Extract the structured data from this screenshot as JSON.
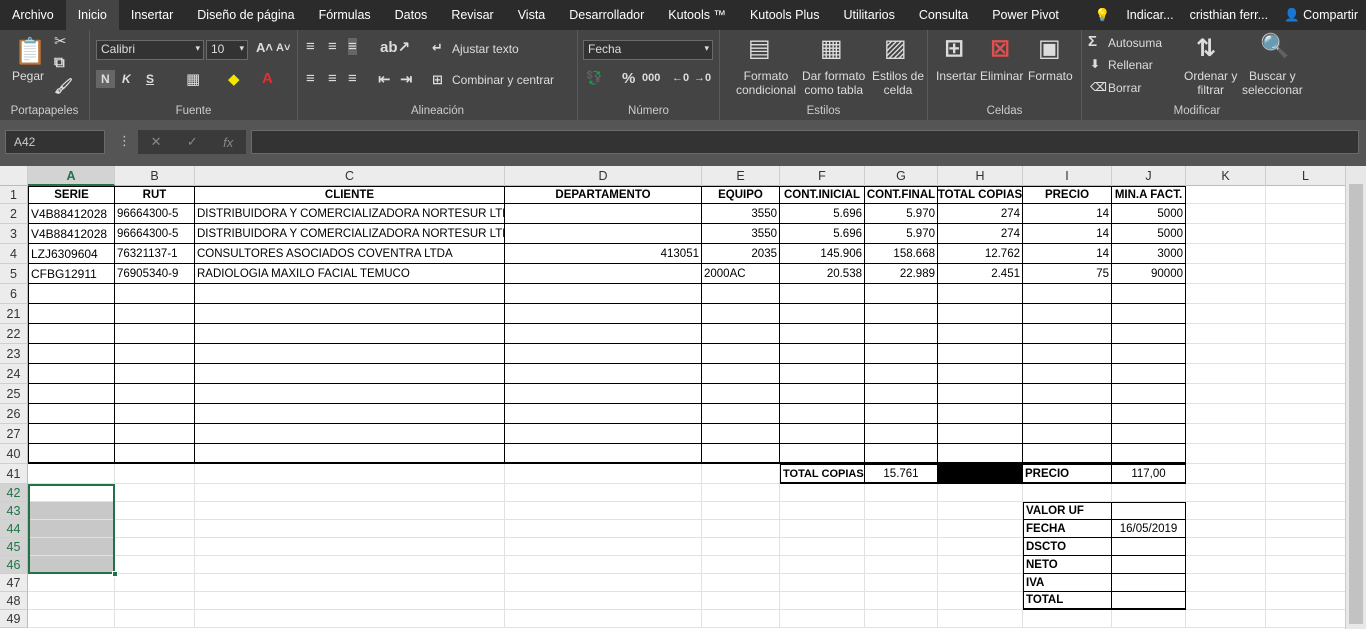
{
  "menu": {
    "tabs": [
      "Archivo",
      "Inicio",
      "Insertar",
      "Diseño de página",
      "Fórmulas",
      "Datos",
      "Revisar",
      "Vista",
      "Desarrollador",
      "Kutools ™",
      "Kutools Plus",
      "Utilitarios",
      "Consulta",
      "Power Pivot"
    ],
    "search": "Indicar...",
    "user": "cristhian ferr...",
    "share": "Compartir"
  },
  "ribbon": {
    "portapapeles": {
      "paste": "Pegar",
      "label": "Portapapeles"
    },
    "fuente": {
      "font": "Calibri",
      "size": "10",
      "bold": "N",
      "italic": "K",
      "underline": "S",
      "label": "Fuente"
    },
    "alineacion": {
      "wrap": "Ajustar texto",
      "merge": "Combinar y centrar",
      "label": "Alineación"
    },
    "numero": {
      "format": "Fecha",
      "label": "Número"
    },
    "estilos": {
      "cond1": "Formato",
      "cond2": "condicional",
      "table1": "Dar formato",
      "table2": "como tabla",
      "cell1": "Estilos de",
      "cell2": "celda",
      "label": "Estilos"
    },
    "celdas": {
      "insert": "Insertar",
      "delete": "Eliminar",
      "format": "Formato",
      "label": "Celdas"
    },
    "modificar": {
      "autosum": "Autosuma",
      "fill": "Rellenar",
      "clear": "Borrar",
      "sort1": "Ordenar y",
      "sort2": "filtrar",
      "find1": "Buscar y",
      "find2": "seleccionar",
      "label": "Modificar"
    }
  },
  "formula_bar": {
    "name_box": "A42",
    "fx": "fx",
    "content": ""
  },
  "columns": [
    "A",
    "B",
    "C",
    "D",
    "E",
    "F",
    "G",
    "H",
    "I",
    "J",
    "K",
    "L"
  ],
  "header_row": [
    "SERIE",
    "RUT",
    "CLIENTE",
    "DEPARTAMENTO",
    "EQUIPO",
    "CONT.INICIAL",
    "CONT.FINAL",
    "TOTAL COPIAS",
    "PRECIO",
    "MIN.A FACT."
  ],
  "data_rows": [
    [
      "V4B88412028",
      "96664300-5",
      "DISTRIBUIDORA Y COMERCIALIZADORA NORTESUR LTDA",
      "",
      "3550",
      "5.696",
      "5.970",
      "274",
      "14",
      "5000"
    ],
    [
      "V4B88412028",
      "96664300-5",
      "DISTRIBUIDORA Y COMERCIALIZADORA NORTESUR LTDA",
      "",
      "3550",
      "5.696",
      "5.970",
      "274",
      "14",
      "5000"
    ],
    [
      "LZJ6309604",
      "76321137-1",
      "CONSULTORES ASOCIADOS COVENTRA LTDA",
      "413051",
      "2035",
      "145.906",
      "158.668",
      "12.762",
      "14",
      "3000"
    ],
    [
      "CFBG12911",
      "76905340-9",
      "RADIOLOGIA MAXILO FACIAL TEMUCO",
      "",
      "2000AC",
      "20.538",
      "22.989",
      "2.451",
      "75",
      "90000"
    ]
  ],
  "row_numbers": [
    "1",
    "2",
    "3",
    "4",
    "5",
    "6",
    "21",
    "22",
    "23",
    "24",
    "25",
    "26",
    "27",
    "40",
    "41",
    "42",
    "43",
    "44",
    "45",
    "46",
    "47",
    "48",
    "49"
  ],
  "totals": {
    "label": "TOTAL COPIAS",
    "value": "15.761",
    "price_label": "PRECIO",
    "price_value": "117,00"
  },
  "summary": [
    {
      "label": "VALOR UF",
      "value": ""
    },
    {
      "label": "FECHA",
      "value": "16/05/2019"
    },
    {
      "label": "DSCTO",
      "value": ""
    },
    {
      "label": "NETO",
      "value": ""
    },
    {
      "label": "IVA",
      "value": ""
    },
    {
      "label": "TOTAL",
      "value": ""
    }
  ]
}
